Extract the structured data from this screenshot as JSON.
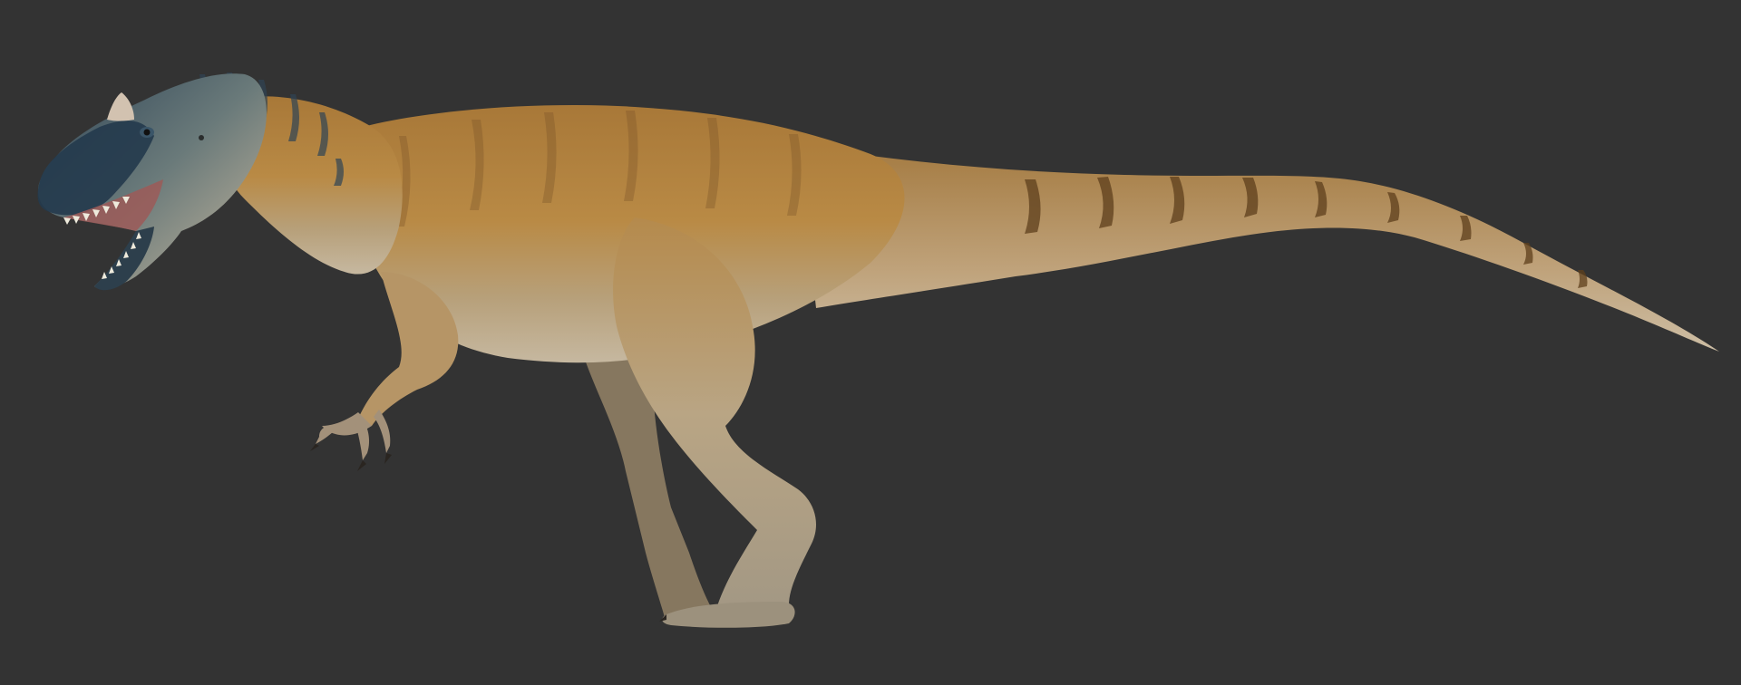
{
  "scene": {
    "subject": "allosauroid-theropod-render",
    "background_color": "#333333",
    "colors": {
      "body_main": "#b6853f",
      "body_light": "#c99a55",
      "belly": "#b9ab93",
      "belly_light": "#cbbfa8",
      "stripe": "#5e3f1c",
      "face_mask": "#243a4c",
      "face_mask_light": "#3a5568",
      "teeth": "#eeeadc",
      "mouth": "#9c5a58",
      "claw": "#2a2520",
      "crest": "#d2c2b0",
      "eye": "#111111"
    }
  }
}
